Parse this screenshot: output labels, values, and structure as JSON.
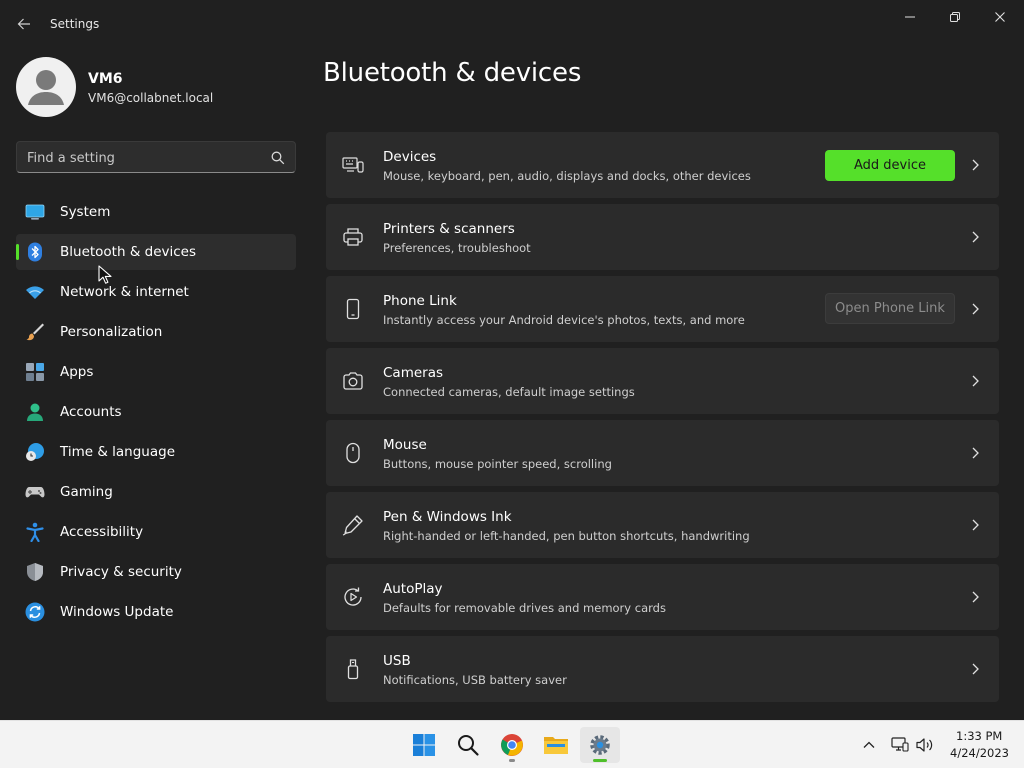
{
  "window": {
    "title": "Settings"
  },
  "user": {
    "name": "VM6",
    "email": "VM6@collabnet.local"
  },
  "search": {
    "placeholder": "Find a setting"
  },
  "nav": {
    "items": [
      {
        "label": "System",
        "icon": "monitor-icon"
      },
      {
        "label": "Bluetooth & devices",
        "icon": "bluetooth-icon",
        "selected": true
      },
      {
        "label": "Network & internet",
        "icon": "wifi-icon"
      },
      {
        "label": "Personalization",
        "icon": "paintbrush-icon"
      },
      {
        "label": "Apps",
        "icon": "apps-icon"
      },
      {
        "label": "Accounts",
        "icon": "person-icon"
      },
      {
        "label": "Time & language",
        "icon": "globe-clock-icon"
      },
      {
        "label": "Gaming",
        "icon": "gamepad-icon"
      },
      {
        "label": "Accessibility",
        "icon": "accessibility-icon"
      },
      {
        "label": "Privacy & security",
        "icon": "shield-icon"
      },
      {
        "label": "Windows Update",
        "icon": "update-icon"
      }
    ]
  },
  "main": {
    "title": "Bluetooth & devices",
    "cards": [
      {
        "title": "Devices",
        "desc": "Mouse, keyboard, pen, audio, displays and docks, other devices",
        "icon": "devices-icon",
        "button": "Add device"
      },
      {
        "title": "Printers & scanners",
        "desc": "Preferences, troubleshoot",
        "icon": "printer-icon"
      },
      {
        "title": "Phone Link",
        "desc": "Instantly access your Android device's photos, texts, and more",
        "icon": "phone-icon",
        "button": "Open Phone Link"
      },
      {
        "title": "Cameras",
        "desc": "Connected cameras, default image settings",
        "icon": "camera-icon"
      },
      {
        "title": "Mouse",
        "desc": "Buttons, mouse pointer speed, scrolling",
        "icon": "mouse-icon"
      },
      {
        "title": "Pen & Windows Ink",
        "desc": "Right-handed or left-handed, pen button shortcuts, handwriting",
        "icon": "pen-icon"
      },
      {
        "title": "AutoPlay",
        "desc": "Defaults for removable drives and memory cards",
        "icon": "autoplay-icon"
      },
      {
        "title": "USB",
        "desc": "Notifications, USB battery saver",
        "icon": "usb-icon"
      }
    ]
  },
  "taskbar": {
    "apps": [
      "start-icon",
      "search-icon",
      "chrome-icon",
      "file-explorer-icon",
      "settings-icon"
    ],
    "time": "1:33 PM",
    "date": "4/24/2023"
  },
  "colors": {
    "accent": "#55e02a",
    "background": "#202020",
    "card": "#2b2b2b",
    "taskbar": "#f3f3f3"
  }
}
